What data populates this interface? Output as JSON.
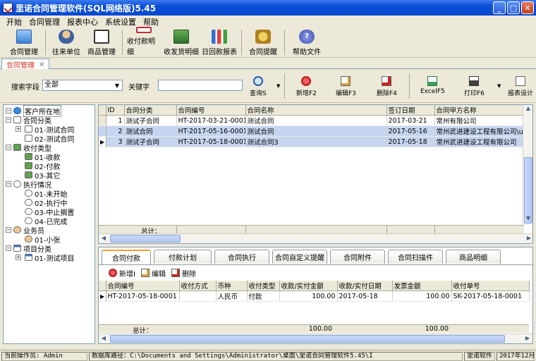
{
  "window": {
    "title": "里诺合同管理软件(SQL网络版)5.45"
  },
  "menu": [
    "开始",
    "合同管理",
    "报表中心",
    "系统设置",
    "帮助"
  ],
  "toolbar": {
    "items": [
      "合同管理",
      "往来单位",
      "商品管理",
      "收付款明细",
      "收发货明细",
      "日回款报表",
      "合同提醒",
      "帮助文件"
    ]
  },
  "doc_tab": {
    "label": "合同管理",
    "close": "×"
  },
  "search": {
    "field_label": "搜索字段",
    "field_value": "全部",
    "keyword_label": "关键字",
    "keyword_value": "",
    "buttons": [
      "查询S",
      "新增F2",
      "编辑F3",
      "删除F4",
      "ExcelF5",
      "打印F6",
      "报表设计"
    ]
  },
  "tree": {
    "root": "客户所在地",
    "contract_category": "合同分类",
    "contract_children": [
      "01-测试合同",
      "02-测试合同"
    ],
    "pay_type": "收付类型",
    "pay_children": [
      "01-收款",
      "02-付款",
      "03-其它"
    ],
    "exec_status": "执行情况",
    "exec_children": [
      "01-未开始",
      "02-执行中",
      "03-中止搁置",
      "04-已完成"
    ],
    "salesman": "业务员",
    "salesman_children": [
      "01-小张"
    ],
    "project_category": "项目分类",
    "project_children": [
      "01-测试项目"
    ]
  },
  "main_grid": {
    "columns": [
      "ID",
      "合同分类",
      "合同编号",
      "合同名称",
      "签订日期",
      "合同甲方名称"
    ],
    "rows": [
      [
        "1",
        "测试子合同",
        "HT-2017-03-21-0001",
        "测试合同",
        "2017-03-21",
        "常州有限公司"
      ],
      [
        "2",
        "测试合同",
        "HT-2017-05-16-0001",
        "测试合同",
        "2017-05-16",
        "常州武进建设工程有限公司\\u"
      ],
      [
        "3",
        "测试子合同",
        "HT-2017-05-18-0001",
        "测试合同3",
        "2017-05-18",
        "常州武进建设工程有限公司"
      ]
    ],
    "total_label": "总计："
  },
  "bottom": {
    "tabs": [
      "合同付款",
      "付款计划",
      "合同执行",
      "合同自定义提醒",
      "合同附件",
      "合同扫描件",
      "商品明细"
    ],
    "actions": [
      "新增I",
      "编辑",
      "删除"
    ],
    "columns": [
      "合同编号",
      "收付方式",
      "币种",
      "收付类型",
      "收款/实付金额",
      "收款/实付日期",
      "发票金额",
      "收付单号"
    ],
    "rows": [
      [
        "HT-2017-05-18-0001",
        "",
        "人民币",
        "付款",
        "100.00",
        "2017-05-18",
        "100.00",
        "SK-2017-05-18-0001"
      ]
    ],
    "total_label": "总计：",
    "totals": {
      "amount": "100.00",
      "invoice": "100.00"
    }
  },
  "status": {
    "operator": "当前操作员: Admin",
    "db_path": "数据库路径：C:\\Documents and Settings\\Administrator\\桌面\\里诺合同管理软件5.45\\I",
    "brand": "里诺软件",
    "date": "2017年12月"
  }
}
